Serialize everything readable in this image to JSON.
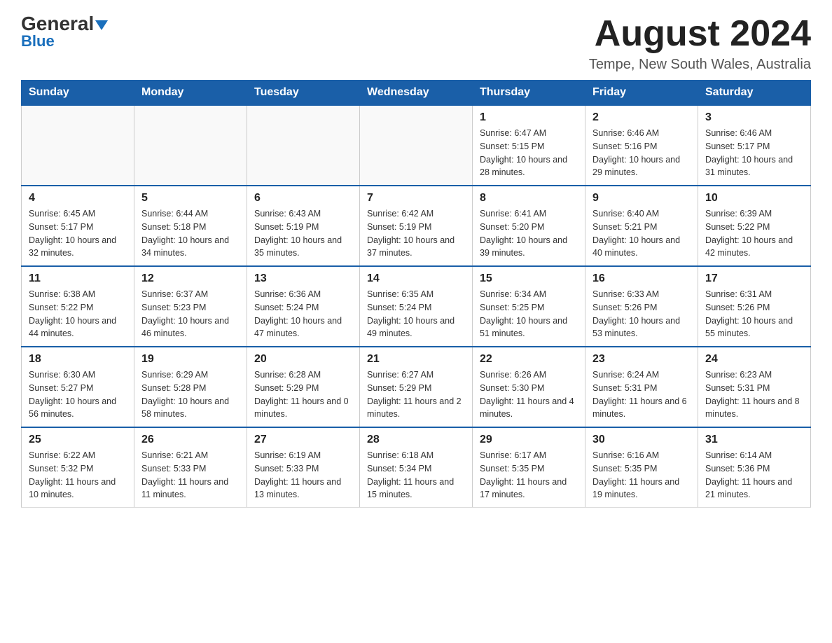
{
  "header": {
    "logo_general": "General",
    "logo_blue": "Blue",
    "month_year": "August 2024",
    "location": "Tempe, New South Wales, Australia"
  },
  "weekdays": [
    "Sunday",
    "Monday",
    "Tuesday",
    "Wednesday",
    "Thursday",
    "Friday",
    "Saturday"
  ],
  "weeks": [
    [
      {
        "day": "",
        "info": ""
      },
      {
        "day": "",
        "info": ""
      },
      {
        "day": "",
        "info": ""
      },
      {
        "day": "",
        "info": ""
      },
      {
        "day": "1",
        "info": "Sunrise: 6:47 AM\nSunset: 5:15 PM\nDaylight: 10 hours and 28 minutes."
      },
      {
        "day": "2",
        "info": "Sunrise: 6:46 AM\nSunset: 5:16 PM\nDaylight: 10 hours and 29 minutes."
      },
      {
        "day": "3",
        "info": "Sunrise: 6:46 AM\nSunset: 5:17 PM\nDaylight: 10 hours and 31 minutes."
      }
    ],
    [
      {
        "day": "4",
        "info": "Sunrise: 6:45 AM\nSunset: 5:17 PM\nDaylight: 10 hours and 32 minutes."
      },
      {
        "day": "5",
        "info": "Sunrise: 6:44 AM\nSunset: 5:18 PM\nDaylight: 10 hours and 34 minutes."
      },
      {
        "day": "6",
        "info": "Sunrise: 6:43 AM\nSunset: 5:19 PM\nDaylight: 10 hours and 35 minutes."
      },
      {
        "day": "7",
        "info": "Sunrise: 6:42 AM\nSunset: 5:19 PM\nDaylight: 10 hours and 37 minutes."
      },
      {
        "day": "8",
        "info": "Sunrise: 6:41 AM\nSunset: 5:20 PM\nDaylight: 10 hours and 39 minutes."
      },
      {
        "day": "9",
        "info": "Sunrise: 6:40 AM\nSunset: 5:21 PM\nDaylight: 10 hours and 40 minutes."
      },
      {
        "day": "10",
        "info": "Sunrise: 6:39 AM\nSunset: 5:22 PM\nDaylight: 10 hours and 42 minutes."
      }
    ],
    [
      {
        "day": "11",
        "info": "Sunrise: 6:38 AM\nSunset: 5:22 PM\nDaylight: 10 hours and 44 minutes."
      },
      {
        "day": "12",
        "info": "Sunrise: 6:37 AM\nSunset: 5:23 PM\nDaylight: 10 hours and 46 minutes."
      },
      {
        "day": "13",
        "info": "Sunrise: 6:36 AM\nSunset: 5:24 PM\nDaylight: 10 hours and 47 minutes."
      },
      {
        "day": "14",
        "info": "Sunrise: 6:35 AM\nSunset: 5:24 PM\nDaylight: 10 hours and 49 minutes."
      },
      {
        "day": "15",
        "info": "Sunrise: 6:34 AM\nSunset: 5:25 PM\nDaylight: 10 hours and 51 minutes."
      },
      {
        "day": "16",
        "info": "Sunrise: 6:33 AM\nSunset: 5:26 PM\nDaylight: 10 hours and 53 minutes."
      },
      {
        "day": "17",
        "info": "Sunrise: 6:31 AM\nSunset: 5:26 PM\nDaylight: 10 hours and 55 minutes."
      }
    ],
    [
      {
        "day": "18",
        "info": "Sunrise: 6:30 AM\nSunset: 5:27 PM\nDaylight: 10 hours and 56 minutes."
      },
      {
        "day": "19",
        "info": "Sunrise: 6:29 AM\nSunset: 5:28 PM\nDaylight: 10 hours and 58 minutes."
      },
      {
        "day": "20",
        "info": "Sunrise: 6:28 AM\nSunset: 5:29 PM\nDaylight: 11 hours and 0 minutes."
      },
      {
        "day": "21",
        "info": "Sunrise: 6:27 AM\nSunset: 5:29 PM\nDaylight: 11 hours and 2 minutes."
      },
      {
        "day": "22",
        "info": "Sunrise: 6:26 AM\nSunset: 5:30 PM\nDaylight: 11 hours and 4 minutes."
      },
      {
        "day": "23",
        "info": "Sunrise: 6:24 AM\nSunset: 5:31 PM\nDaylight: 11 hours and 6 minutes."
      },
      {
        "day": "24",
        "info": "Sunrise: 6:23 AM\nSunset: 5:31 PM\nDaylight: 11 hours and 8 minutes."
      }
    ],
    [
      {
        "day": "25",
        "info": "Sunrise: 6:22 AM\nSunset: 5:32 PM\nDaylight: 11 hours and 10 minutes."
      },
      {
        "day": "26",
        "info": "Sunrise: 6:21 AM\nSunset: 5:33 PM\nDaylight: 11 hours and 11 minutes."
      },
      {
        "day": "27",
        "info": "Sunrise: 6:19 AM\nSunset: 5:33 PM\nDaylight: 11 hours and 13 minutes."
      },
      {
        "day": "28",
        "info": "Sunrise: 6:18 AM\nSunset: 5:34 PM\nDaylight: 11 hours and 15 minutes."
      },
      {
        "day": "29",
        "info": "Sunrise: 6:17 AM\nSunset: 5:35 PM\nDaylight: 11 hours and 17 minutes."
      },
      {
        "day": "30",
        "info": "Sunrise: 6:16 AM\nSunset: 5:35 PM\nDaylight: 11 hours and 19 minutes."
      },
      {
        "day": "31",
        "info": "Sunrise: 6:14 AM\nSunset: 5:36 PM\nDaylight: 11 hours and 21 minutes."
      }
    ]
  ]
}
